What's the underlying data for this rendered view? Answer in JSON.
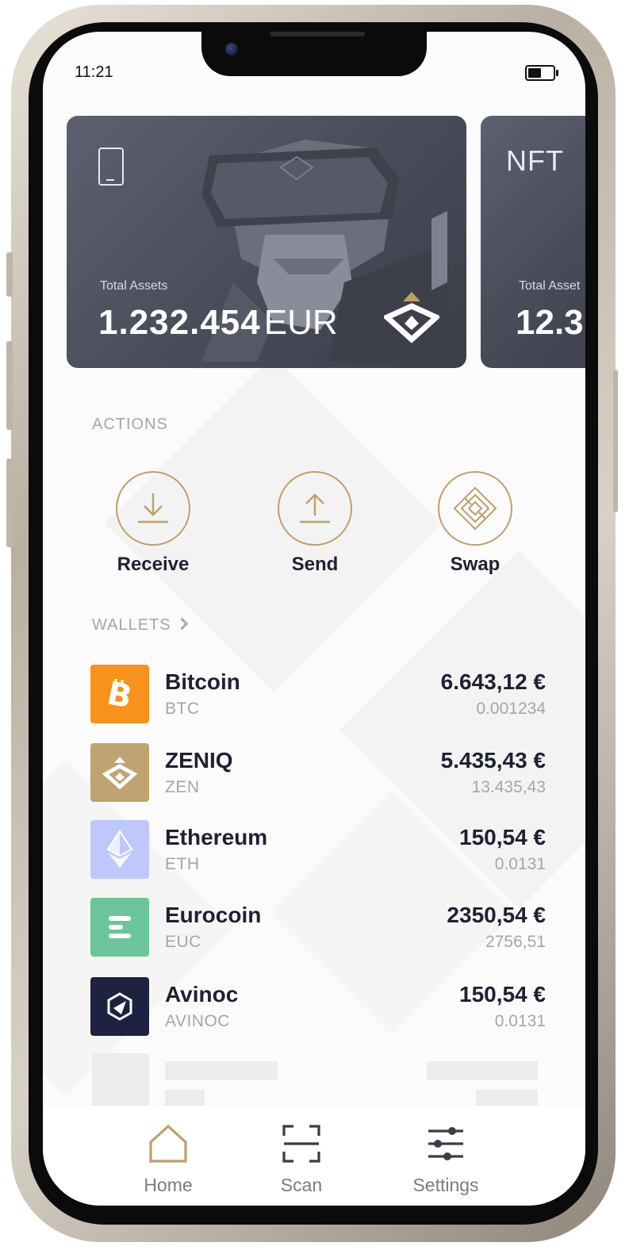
{
  "status_bar": {
    "time": "11:21"
  },
  "cards": [
    {
      "label": "Total Assets",
      "amount": "1.232.454",
      "currency": "EUR"
    },
    {
      "title": "NFT",
      "label": "Total Asset",
      "amount": "12.3"
    }
  ],
  "actions": {
    "header": "ACTIONS",
    "items": [
      {
        "label": "Receive",
        "icon": "receive-icon"
      },
      {
        "label": "Send",
        "icon": "send-icon"
      },
      {
        "label": "Swap",
        "icon": "swap-icon"
      }
    ]
  },
  "wallets": {
    "header": "WALLETS",
    "items": [
      {
        "name": "Bitcoin",
        "code": "BTC",
        "value": "6.643,12 €",
        "amount": "0.001234",
        "icon": "bitcoin-icon",
        "color": "#F7931A"
      },
      {
        "name": "ZENIQ",
        "code": "ZEN",
        "value": "5.435,43 €",
        "amount": "13.435,43",
        "icon": "zeniq-icon",
        "color": "#BFA370"
      },
      {
        "name": "Ethereum",
        "code": "ETH",
        "value": "150,54 €",
        "amount": "0.0131",
        "icon": "ethereum-icon",
        "color": "#BFC8FD"
      },
      {
        "name": "Eurocoin",
        "code": "EUC",
        "value": "2350,54 €",
        "amount": "2756,51",
        "icon": "eurocoin-icon",
        "color": "#6BC59A"
      },
      {
        "name": "Avinoc",
        "code": "AVINOC",
        "value": "150,54 €",
        "amount": "0.0131",
        "icon": "avinoc-icon",
        "color": "#1E2240"
      }
    ]
  },
  "tabbar": {
    "items": [
      {
        "label": "Home",
        "icon": "home-icon",
        "active": true
      },
      {
        "label": "Scan",
        "icon": "scan-icon",
        "active": false
      },
      {
        "label": "Settings",
        "icon": "settings-icon",
        "active": false
      }
    ]
  },
  "colors": {
    "accent": "#BF9F6A",
    "text": "#1E2131",
    "muted": "#A5A6AB",
    "card": "#4A4D5A"
  }
}
